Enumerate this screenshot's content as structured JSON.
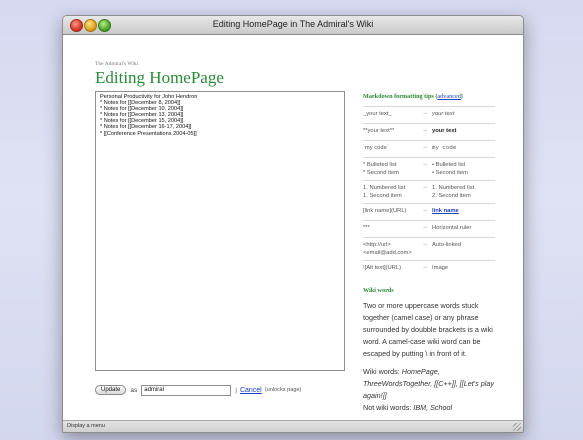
{
  "window": {
    "title": "Editing HomePage in The Admiral's Wiki"
  },
  "status_bar": {
    "text": "Display a menu"
  },
  "page": {
    "wiki_name": "The Admiral's Wiki",
    "title": "Editing HomePage"
  },
  "editor": {
    "lines": [
      "Personal Productivity for John Hendron",
      "* Notes for [[December 8, 2004]]",
      "* Notes for [[December 10, 2004]]",
      "* Notes for [[December 13, 2004]]",
      "* Notes for [[December 15, 2004]]",
      "* Notes for [[December 16-17, 2004]]",
      "* [[Conference Presentations 2004-05]]"
    ]
  },
  "form": {
    "update_label": "Update",
    "as_label": "as",
    "author_value": "admiral",
    "separator": "|",
    "cancel_label": "Cancel",
    "unlocks_note": "(unlocks page)"
  },
  "sidebar": {
    "tips_heading": "Markdown formatting tips",
    "advanced_link": "advanced",
    "arrow": "→",
    "tips": [
      {
        "src": [
          "_your text_"
        ],
        "res": [
          "your text"
        ],
        "style": "italic"
      },
      {
        "src": [
          "**your text**"
        ],
        "res": [
          "your text"
        ],
        "style": "bold"
      },
      {
        "src": [
          "`my code`"
        ],
        "res": [
          "my  code"
        ],
        "style": "mono"
      },
      {
        "src": [
          "* Bulleted list",
          "* Second item"
        ],
        "res": [
          "• Bulleted list",
          "• Second item"
        ],
        "style": "plain"
      },
      {
        "src": [
          "1. Numbered list",
          "1. Second item"
        ],
        "res": [
          "1. Numbered list",
          "2. Second item"
        ],
        "style": "plain"
      },
      {
        "src": [
          "[link name](URL)"
        ],
        "res": [
          "link name"
        ],
        "style": "link"
      },
      {
        "src": [
          "***"
        ],
        "res": [
          "Horizontal ruler"
        ],
        "style": "plain"
      },
      {
        "src": [
          "<http://url>",
          "<email@add.com>"
        ],
        "res": [
          "Auto-linked"
        ],
        "style": "plain"
      },
      {
        "src": [
          "![Alt text](URL)"
        ],
        "res": [
          "Image"
        ],
        "style": "plain"
      }
    ],
    "wiki_words_heading": "Wiki words",
    "wiki_desc": "Two or more uppercase words stuck together (camel case) or any phrase surrounded by doubble brackets is a wiki word. A camel-case wiki word can be escaped by putting \\ in front of it.",
    "examples_prefix": "Wiki words:",
    "examples": "HomePage, ThreeWordsTogether, [[C++]], [[Let's play again!]]",
    "not_prefix": "Not wiki words:",
    "not_examples": "IBM, School"
  }
}
